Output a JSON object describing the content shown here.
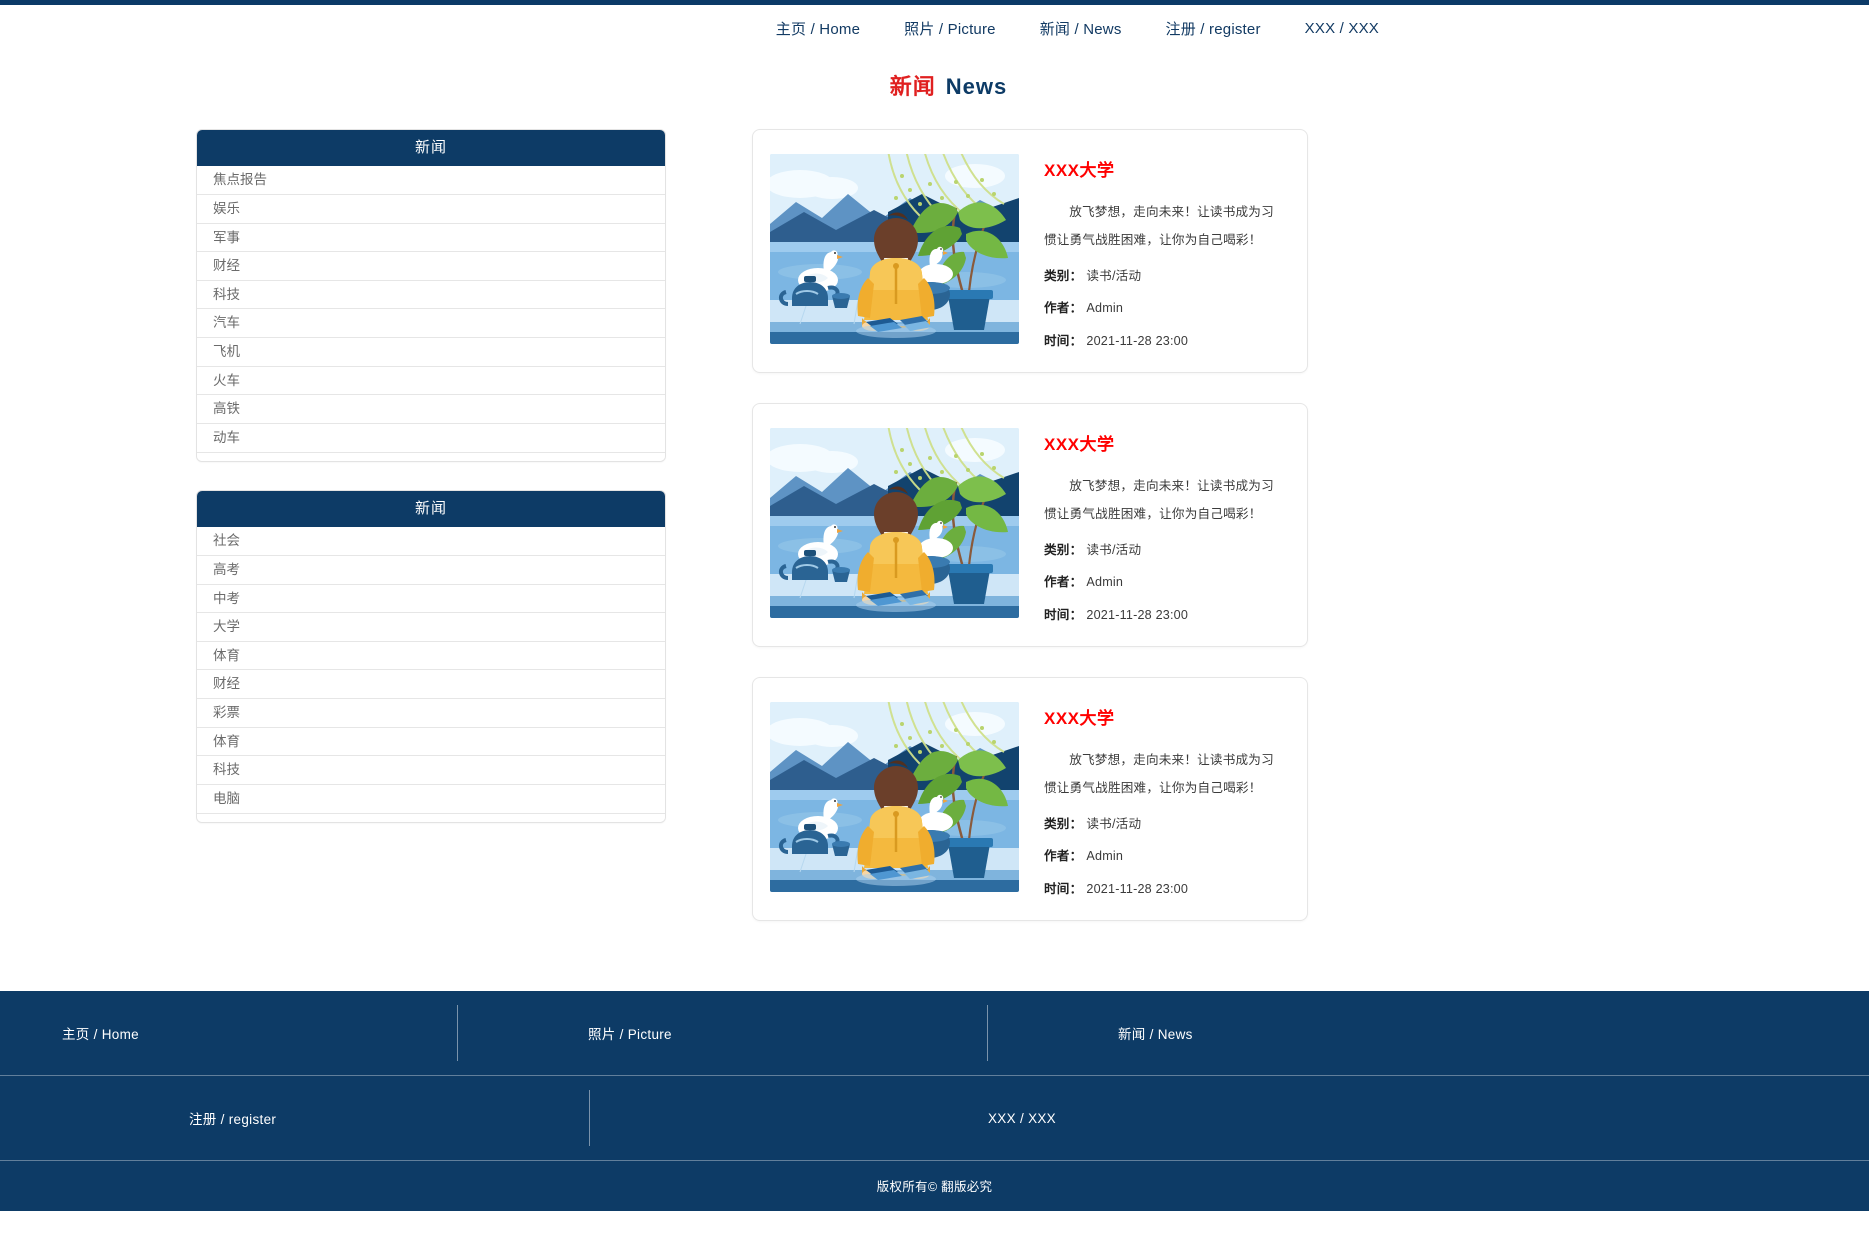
{
  "topnav": {
    "items": [
      {
        "label": "主页 / Home",
        "name": "nav-home"
      },
      {
        "label": "照片 / Picture",
        "name": "nav-picture"
      },
      {
        "label": "新闻 / News",
        "name": "nav-news"
      },
      {
        "label": "注册 / register",
        "name": "nav-register"
      },
      {
        "label": "XXX / XXX",
        "name": "nav-xxx"
      }
    ]
  },
  "page": {
    "title_cn": "新闻",
    "title_en": "News"
  },
  "sidebar": {
    "panels": [
      {
        "heading": "新闻",
        "items": [
          "焦点报告",
          "娱乐",
          "军事",
          "财经",
          "科技",
          "汽车",
          "飞机",
          "火车",
          "高铁",
          "动车"
        ]
      },
      {
        "heading": "新闻",
        "items": [
          "社会",
          "高考",
          "中考",
          "大学",
          "体育",
          "财经",
          "彩票",
          "体育",
          "科技",
          "电脑"
        ]
      }
    ]
  },
  "news": {
    "cards": [
      {
        "title": "XXX大学",
        "desc": "放飞梦想，走向未来！让读书成为习惯让勇气战胜困难，让你为自己喝彩！",
        "category_label": "类别：",
        "category_value": "读书/活动",
        "author_label": "作者：",
        "author_value": "Admin",
        "time_label": "时间：",
        "time_value": "2021-11-28 23:00",
        "image_alt": "illustration-person-by-water"
      },
      {
        "title": "XXX大学",
        "desc": "放飞梦想，走向未来！让读书成为习惯让勇气战胜困难，让你为自己喝彩！",
        "category_label": "类别：",
        "category_value": "读书/活动",
        "author_label": "作者：",
        "author_value": "Admin",
        "time_label": "时间：",
        "time_value": "2021-11-28 23:00",
        "image_alt": "illustration-person-by-water"
      },
      {
        "title": "XXX大学",
        "desc": "放飞梦想，走向未来！让读书成为习惯让勇气战胜困难，让你为自己喝彩！",
        "category_label": "类别：",
        "category_value": "读书/活动",
        "author_label": "作者：",
        "author_value": "Admin",
        "time_label": "时间：",
        "time_value": "2021-11-28 23:00",
        "image_alt": "illustration-person-by-water"
      }
    ]
  },
  "footer": {
    "row1": [
      {
        "label": "主页 / Home",
        "name": "footer-home"
      },
      {
        "label": "照片 / Picture",
        "name": "footer-picture"
      },
      {
        "label": "新闻 / News",
        "name": "footer-news"
      }
    ],
    "row2": [
      {
        "label": "注册 / register",
        "name": "footer-register"
      },
      {
        "label": "XXX / XXX",
        "name": "footer-xxx"
      }
    ],
    "copyright": "版权所有© 翻版必究"
  },
  "colors": {
    "navy": "#0d3b66",
    "title_red": "#e02020",
    "card_title_red": "#ff0000",
    "border_grey": "#e6e6e6"
  }
}
